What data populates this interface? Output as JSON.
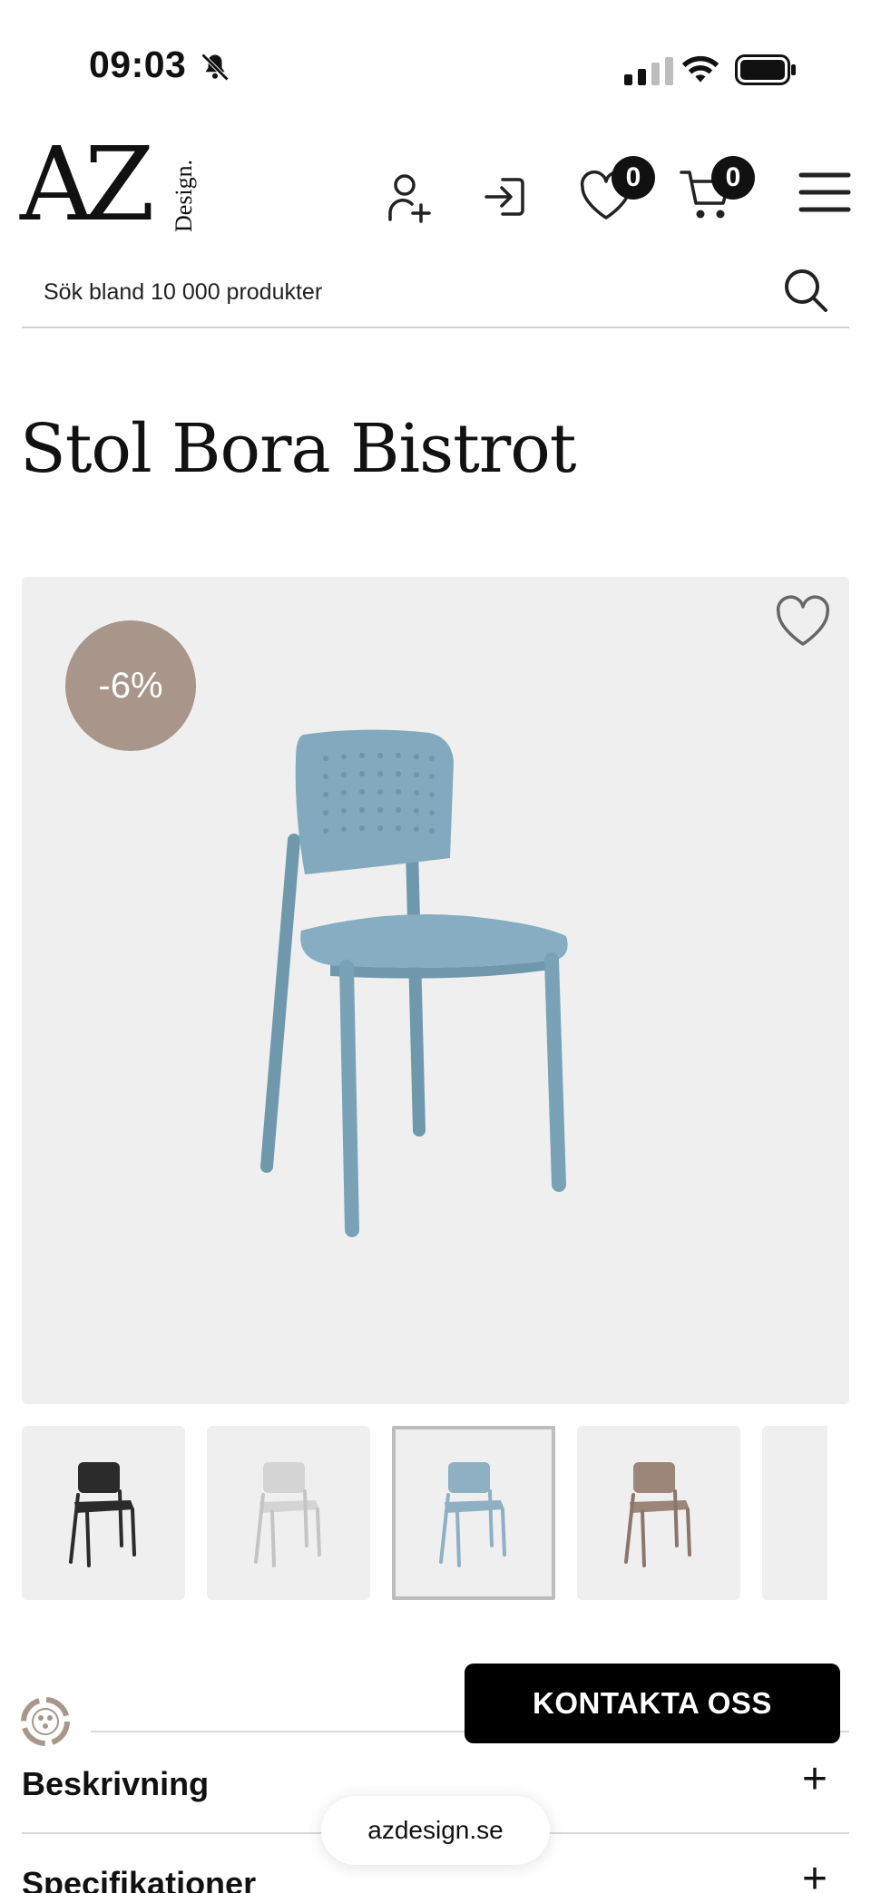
{
  "status_bar": {
    "time": "09:03"
  },
  "header": {
    "logo_main": "AZ",
    "logo_sub": "Design.",
    "wishlist_count": "0",
    "cart_count": "0"
  },
  "search": {
    "placeholder": "Sök bland 10 000 produkter"
  },
  "product": {
    "title": "Stol Bora Bistrot",
    "discount_badge": "-6%",
    "colors": {
      "badge": "#a8968a",
      "chair": "#7fa3b6"
    },
    "thumbnails": [
      {
        "color": "#2b2b2b",
        "active": false
      },
      {
        "color": "#d4d4d4",
        "active": false
      },
      {
        "color": "#8fb0c2",
        "active": true
      },
      {
        "color": "#9b8679",
        "active": false
      },
      {
        "color": "#5e7350",
        "active": false
      }
    ]
  },
  "contact_button": "KONTAKTA OSS",
  "accordion": [
    {
      "label": "Beskrivning",
      "icon": "+"
    },
    {
      "label": "Specifikationer",
      "icon": "+"
    }
  ],
  "browser": {
    "url": "azdesign.se"
  }
}
